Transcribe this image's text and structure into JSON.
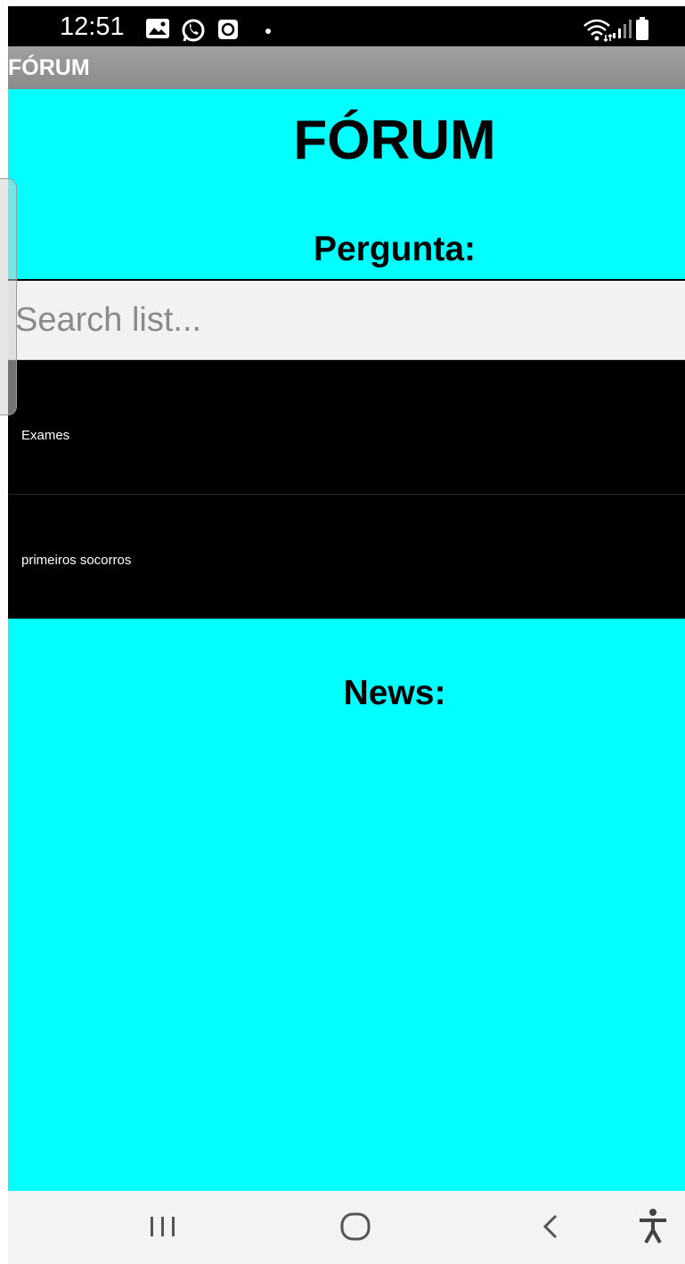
{
  "status_bar": {
    "time": "12:51",
    "icons": [
      "gallery-icon",
      "whatsapp-icon",
      "clock-icon",
      "dot-icon",
      "wifi-icon",
      "signal-icon",
      "battery-icon"
    ]
  },
  "action_bar": {
    "title": "FÓRUM"
  },
  "main": {
    "title": "FÓRUM",
    "question_heading": "Pergunta:",
    "search": {
      "placeholder": "Search list..."
    },
    "list_items": [
      {
        "label": "Exames"
      },
      {
        "label": "primeiros socorros"
      }
    ],
    "news_heading": "News:"
  },
  "nav_bar": {
    "buttons": [
      "recents-icon",
      "home-icon",
      "back-icon",
      "accessibility-icon"
    ]
  },
  "colors": {
    "background": "#00ffff",
    "list_background": "#000000",
    "action_bar": "#999999",
    "status_bar": "#000000",
    "nav_bar": "#f3f3f3"
  }
}
